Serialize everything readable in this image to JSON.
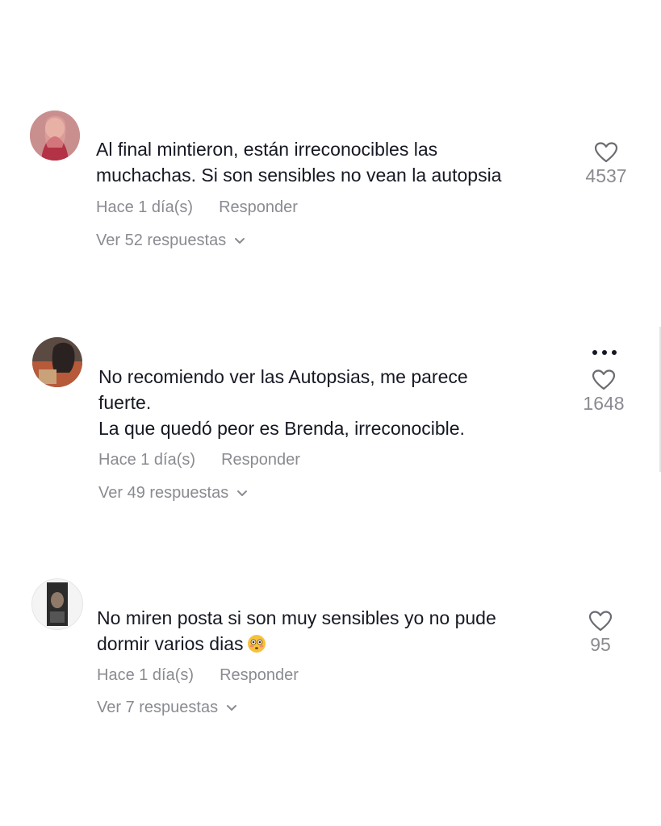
{
  "comments": [
    {
      "text": "Al final mintieron, están irreconocibles las\nmuchachas. Si son sensibles no vean la autopsia",
      "time": "Hace 1 día(s)",
      "reply_label": "Responder",
      "replies_label": "Ver 52 respuestas",
      "likes": "4537",
      "avatar_icon": "user-avatar-photo"
    },
    {
      "text": "No recomiendo ver las Autopsias, me parece\nfuerte.\nLa que quedó peor es Brenda, irreconocible.",
      "time": "Hace 1 día(s)",
      "reply_label": "Responder",
      "replies_label": "Ver 49 respuestas",
      "likes": "1648",
      "avatar_icon": "user-avatar-photo"
    },
    {
      "text": "No miren posta si son muy sensibles yo no pude\ndormir varios dias",
      "emoji": "flushed-face-emoji",
      "time": "Hace 1 día(s)",
      "reply_label": "Responder",
      "replies_label": "Ver 7 respuestas",
      "likes": "95",
      "avatar_icon": "user-avatar-photo"
    }
  ],
  "icons": {
    "like": "heart-outline-icon",
    "expand": "chevron-down-icon",
    "more": "more-options-icon"
  },
  "colors": {
    "text": "#161823",
    "muted": "#8a8b91",
    "background": "#ffffff"
  }
}
